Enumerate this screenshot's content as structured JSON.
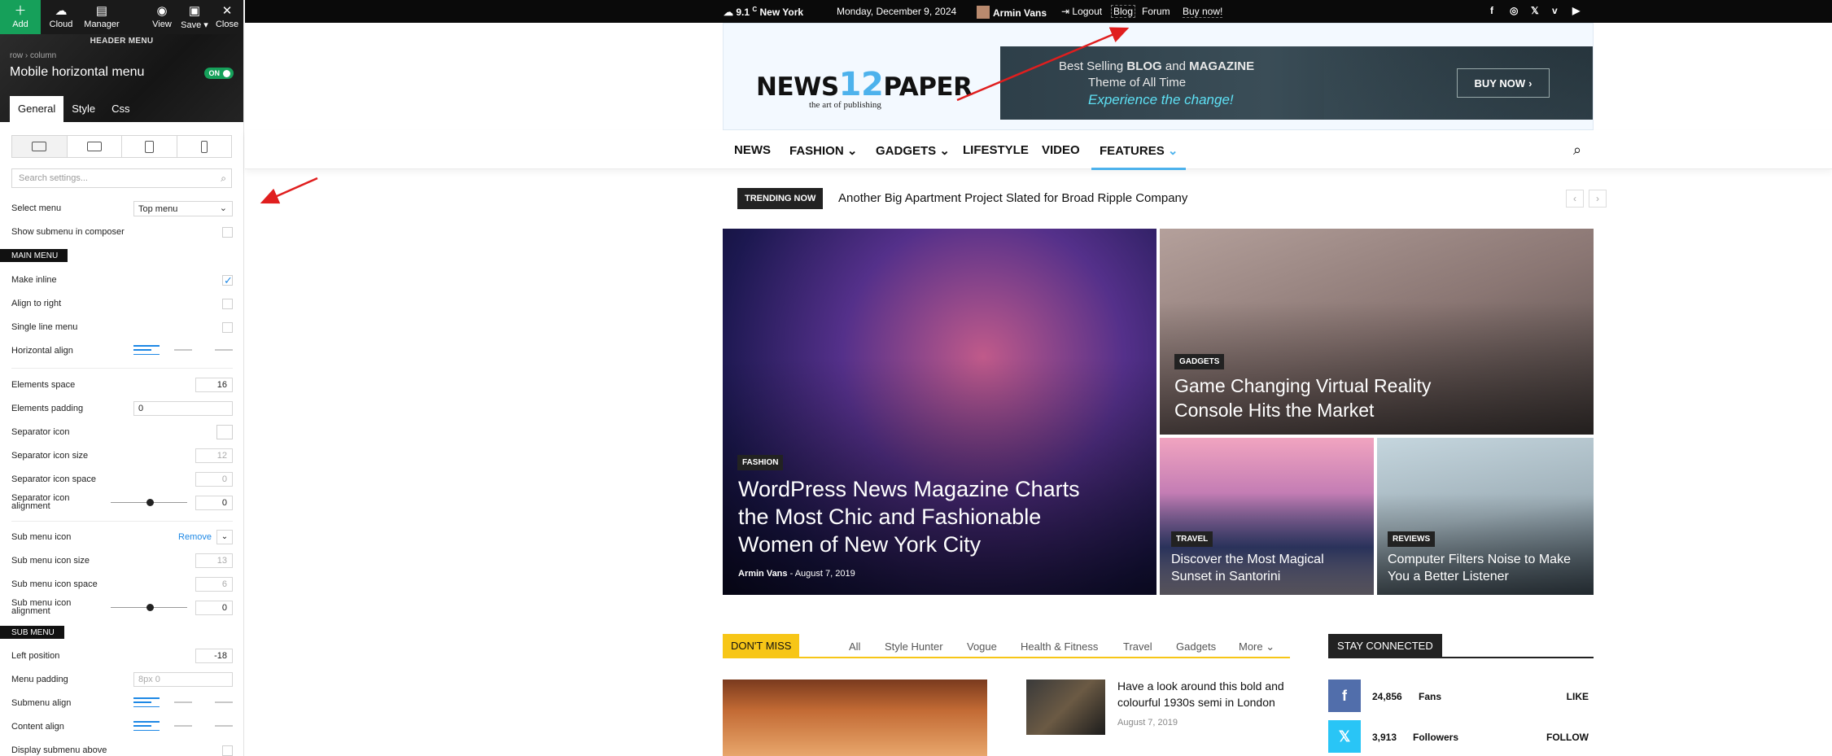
{
  "toolbar": {
    "add": "Add",
    "cloud": "Cloud",
    "manager": "Manager",
    "view": "View",
    "save": "Save ▾",
    "close": "Close"
  },
  "panel": {
    "section_label": "HEADER MENU",
    "breadcrumb": "row › column",
    "title": "Mobile horizontal menu",
    "toggle": "ON",
    "tabs": [
      "General",
      "Style",
      "Css"
    ],
    "search_placeholder": "Search settings...",
    "select_menu_label": "Select menu",
    "select_menu_value": "Top menu",
    "show_submenu_label": "Show submenu in composer",
    "main_menu": "MAIN MENU",
    "make_inline": "Make inline",
    "align_right": "Align to right",
    "single_line": "Single line menu",
    "horizontal_align": "Horizontal align",
    "elements_space": "Elements space",
    "elements_space_value": "16",
    "elements_padding": "Elements padding",
    "elements_padding_value": "0",
    "separator_icon": "Separator icon",
    "separator_icon_size": "Separator icon size",
    "separator_icon_size_value": "12",
    "separator_icon_space": "Separator icon space",
    "separator_icon_space_value": "0",
    "separator_icon_alignment_1": "Separator icon",
    "separator_icon_alignment_2": "alignment",
    "separator_icon_alignment_value": "0",
    "sub_menu_icon": "Sub menu icon",
    "remove": "Remove",
    "sub_menu_icon_size": "Sub menu icon size",
    "sub_menu_icon_size_value": "13",
    "sub_menu_icon_space": "Sub menu icon space",
    "sub_menu_icon_space_value": "6",
    "sub_menu_icon_alignment_1": "Sub menu icon",
    "sub_menu_icon_alignment_2": "alignment",
    "sub_menu_icon_alignment_value": "0",
    "sub_menu": "SUB MENU",
    "left_position": "Left position",
    "left_position_value": "-18",
    "menu_padding": "Menu padding",
    "menu_padding_value": "8px 0",
    "submenu_align": "Submenu align",
    "content_align": "Content align",
    "display_submenu_above": "Display submenu above"
  },
  "topbar": {
    "temp": "9.1",
    "unit": "C",
    "city": "New York",
    "date": "Monday, December 9, 2024",
    "user": "Armin Vans",
    "logout": "Logout",
    "links": [
      "Blog",
      "Forum",
      "Buy now!"
    ],
    "social": [
      "f",
      "◎",
      "𝕏",
      "v",
      "▶"
    ]
  },
  "logo": {
    "left": "NEWS",
    "num": "12",
    "right": "PAPER",
    "tagline": "the art of publishing"
  },
  "banner": {
    "line1_a": "Best Selling ",
    "line1_b": "BLOG",
    "line1_c": " and ",
    "line1_d": "MAGAZINE",
    "line2": "Theme of All Time",
    "line3": "Experience the change!",
    "button": "BUY NOW"
  },
  "nav": {
    "items": [
      "NEWS",
      "FASHION",
      "GADGETS",
      "LIFESTYLE",
      "VIDEO",
      "FEATURES"
    ]
  },
  "trending": {
    "label": "TRENDING NOW",
    "headline": "Another Big Apartment Project Slated for Broad Ripple Company"
  },
  "featured": {
    "main": {
      "cat": "FASHION",
      "title": "WordPress News Magazine Charts the Most Chic and Fashionable Women of New York City",
      "author": "Armin Vans",
      "date": "August 7, 2019"
    },
    "vr": {
      "cat": "GADGETS",
      "title": "Game Changing Virtual Reality Console Hits the Market"
    },
    "travel": {
      "cat": "TRAVEL",
      "title": "Discover the Most Magical Sunset in Santorini"
    },
    "reviews": {
      "cat": "REVIEWS",
      "title": "Computer Filters Noise to Make You a Better Listener"
    }
  },
  "dontmiss": {
    "label": "DON'T MISS",
    "tabs": [
      "All",
      "Style Hunter",
      "Vogue",
      "Health & Fitness",
      "Travel",
      "Gadgets",
      "More"
    ]
  },
  "article": {
    "title": "Have a look around this bold and colourful 1930s semi in London",
    "date": "August 7, 2019"
  },
  "stay": {
    "label": "STAY CONNECTED",
    "rows": [
      {
        "icon": "f",
        "count": "24,856",
        "unit": "Fans",
        "action": "LIKE",
        "color": "#516eab"
      },
      {
        "icon": "𝕏",
        "count": "3,913",
        "unit": "Followers",
        "action": "FOLLOW",
        "color": "#29c5f6"
      }
    ]
  }
}
